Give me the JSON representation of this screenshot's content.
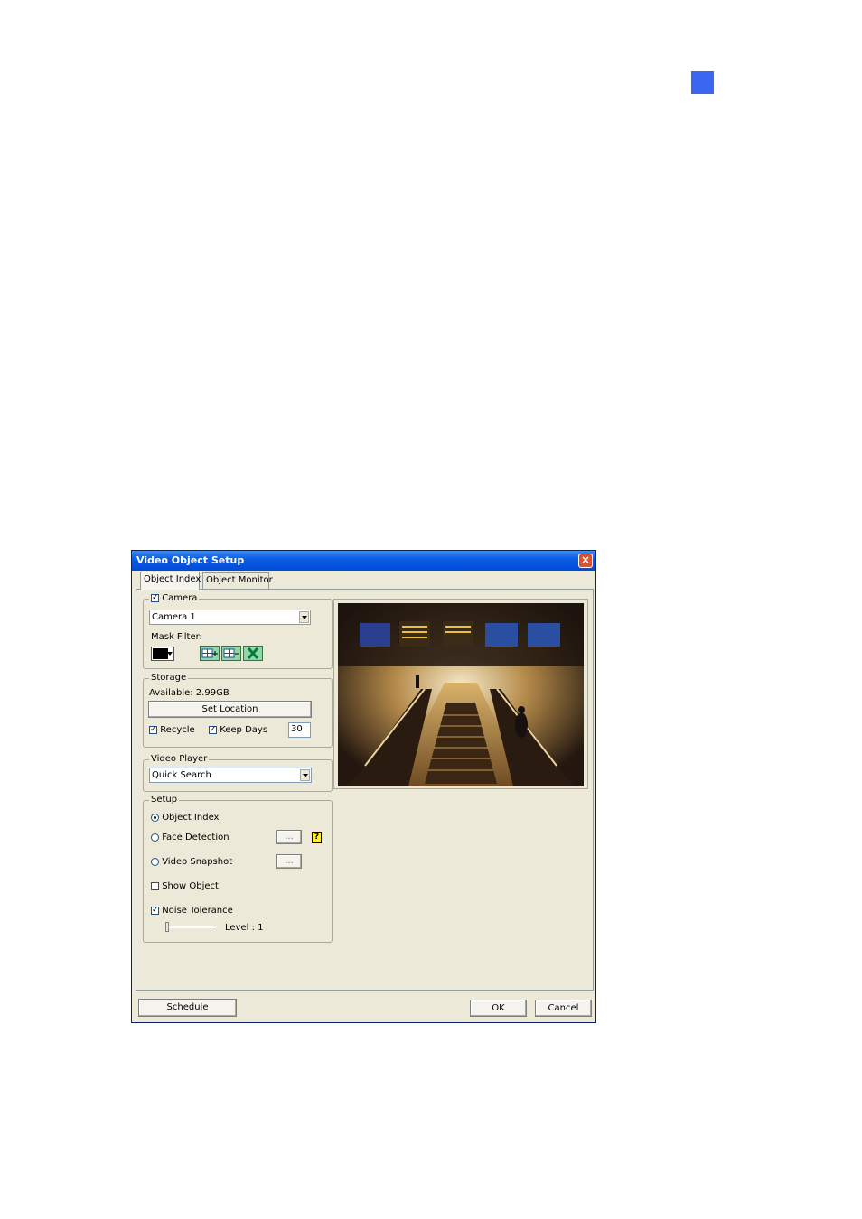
{
  "dialog": {
    "title": "Video Object Setup",
    "tabs": [
      "Object Index",
      "Object Monitor"
    ],
    "camera": {
      "label": "Camera",
      "checked": true,
      "selected": "Camera 1",
      "mask_filter_label": "Mask Filter:",
      "mask_color": "#000000"
    },
    "storage": {
      "label": "Storage",
      "available": "Available: 2.99GB",
      "set_location": "Set Location",
      "recycle_label": "Recycle",
      "recycle_checked": true,
      "keep_days_label": "Keep Days",
      "keep_days_checked": true,
      "keep_days_value": "30"
    },
    "video_player": {
      "label": "Video Player",
      "selected": "Quick Search"
    },
    "setup": {
      "label": "Setup",
      "object_index": "Object Index",
      "face_detection": "Face Detection",
      "video_snapshot": "Video Snapshot",
      "browse": "...",
      "help": "?",
      "show_object": "Show Object",
      "noise_tolerance": "Noise Tolerance",
      "level": "Level : 1"
    },
    "buttons": {
      "schedule": "Schedule",
      "ok": "OK",
      "cancel": "Cancel"
    }
  },
  "colors": {
    "accent_square": "#3a66f0",
    "titlebar": "#0a5ee6",
    "dialog_bg": "#ece9d8"
  }
}
